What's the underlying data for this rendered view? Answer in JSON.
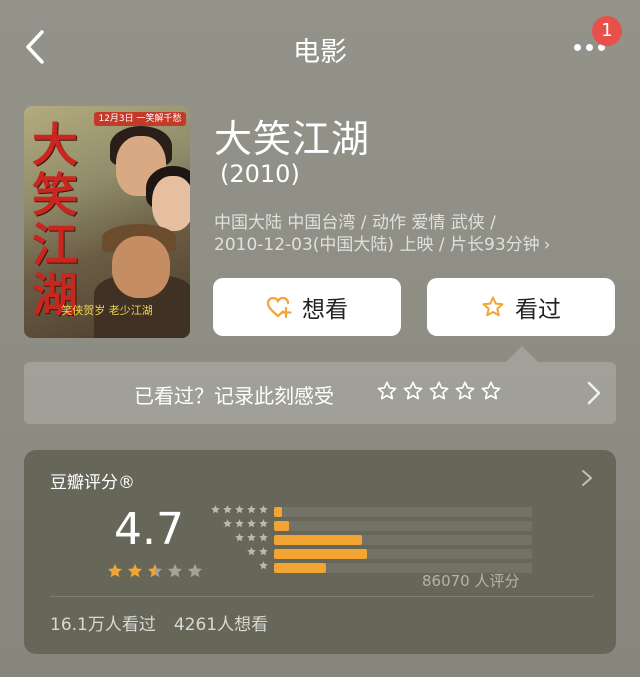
{
  "header": {
    "title": "电影",
    "badge": "1",
    "back_icon": "chevron-left-icon",
    "more_icon": "more-dots-icon"
  },
  "poster": {
    "banner": "12月3日 一笑解千愁",
    "title": "大笑江湖",
    "tagline": "笑侠贺岁 老少江湖"
  },
  "movie": {
    "title": "大笑江湖",
    "year": "(2010)",
    "meta_line1": "中国大陆 中国台湾 / 动作 爱情 武侠 /",
    "meta_line2": "2010-12-03(中国大陆) 上映 / 片长93分钟",
    "meta_chevron": "›"
  },
  "actions": {
    "want_label": "想看",
    "seen_label": "看过",
    "want_icon": "heart-plus-icon",
    "seen_icon": "star-outline-icon"
  },
  "record": {
    "text": "已看过？记录此刻感受",
    "stars_count": 5
  },
  "rating": {
    "label": "豆瓣评分®",
    "score": "4.7",
    "score_stars": 2.5,
    "distribution": [
      {
        "stars": 5,
        "fraction": 0.03
      },
      {
        "stars": 4,
        "fraction": 0.06
      },
      {
        "stars": 3,
        "fraction": 0.34
      },
      {
        "stars": 2,
        "fraction": 0.36
      },
      {
        "stars": 1,
        "fraction": 0.2
      }
    ],
    "count_text": "86070 人评分",
    "watched": "16.1万人看过",
    "wanted": "4261人想看"
  },
  "colors": {
    "accent": "#f2a533",
    "badge": "#e8514b",
    "background": "#8f8f85",
    "card": "#666659"
  }
}
